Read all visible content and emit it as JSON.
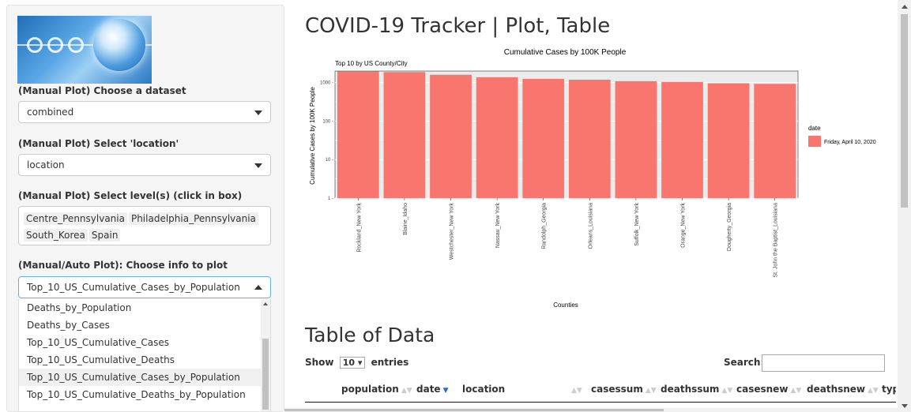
{
  "sidebar": {
    "dataset_label": "(Manual Plot) Choose a dataset",
    "dataset_value": "combined",
    "location_label": "(Manual Plot) Select 'location'",
    "location_value": "location",
    "levels_label": "(Manual Plot) Select level(s) (click in box)",
    "levels": [
      "Centre_Pennsylvania",
      "Philadelphia_Pennsylvania",
      "South_Korea",
      "Spain"
    ],
    "info_label": "(Manual/Auto Plot): Choose info to plot",
    "info_value": "Top_10_US_Cumulative_Cases_by_Population",
    "info_options": [
      "Deaths_by_Population",
      "Deaths_by_Cases",
      "Top_10_US_Cumulative_Cases",
      "Top_10_US_Cumulative_Deaths",
      "Top_10_US_Cumulative_Cases_by_Population",
      "Top_10_US_Cumulative_Deaths_by_Population"
    ],
    "info_active_index": 4
  },
  "main": {
    "title": "COVID-19 Tracker | Plot, Table",
    "table_heading": "Table of Data",
    "show_label": "Show",
    "entries_value": "10",
    "entries_label": "entries",
    "search_label": "Search:",
    "columns": [
      "population",
      "date",
      "location",
      "casessum",
      "deathssum",
      "casesnew",
      "deathsnew",
      "typ"
    ]
  },
  "chart_data": {
    "type": "bar",
    "title": "Cumulative Cases by 100K People",
    "subtitle": "Top 10 by US County/City",
    "xlabel": "Counties",
    "ylabel": "Cumulative Cases by 100K People",
    "y_scale": "log10",
    "ylim": [
      1,
      2000
    ],
    "y_ticks": [
      1,
      10,
      100,
      1000
    ],
    "y_tick_labels": [
      "1 -",
      "10 -",
      "100 -",
      "1000 -"
    ],
    "categories": [
      "Rockland_New York",
      "Blaine_Idaho",
      "Westchester_New York",
      "Nassau_New York",
      "Randolph_Georgia",
      "Orleans_Louisiana",
      "Suffolk_New York",
      "Orange_New York",
      "Dougherty_Georgia",
      "St. John the Baptist_Louisiana"
    ],
    "series": [
      {
        "name": "Friday, April 10, 2020",
        "values": [
          1950,
          1880,
          1600,
          1380,
          1250,
          1190,
          1090,
          1040,
          960,
          930
        ]
      }
    ],
    "legend_title": "date",
    "legend_position": "right",
    "bar_color": "#F8766D",
    "grid": true,
    "panel_background": "#EBEBEB"
  }
}
